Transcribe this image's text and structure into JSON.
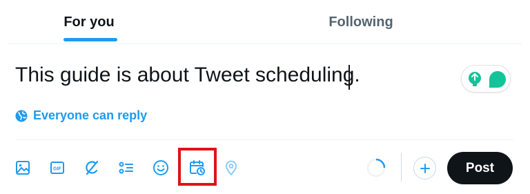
{
  "tabs": [
    {
      "label": "For you",
      "active": true
    },
    {
      "label": "Following",
      "active": false
    }
  ],
  "compose": {
    "text": "This guide is about Tweet scheduling."
  },
  "reply_setting": {
    "label": "Everyone can reply",
    "icon": "globe-icon"
  },
  "toolbar": {
    "icons": [
      "image-icon",
      "gif-icon",
      "grok-icon",
      "poll-icon",
      "emoji-icon",
      "schedule-icon",
      "location-icon"
    ],
    "highlighted": "schedule-icon"
  },
  "post_label": "Post",
  "colors": {
    "accent": "#1d9bf0",
    "highlight": "#e0121a",
    "post_bg": "#0f1419",
    "grammarly": "#15c39a"
  }
}
